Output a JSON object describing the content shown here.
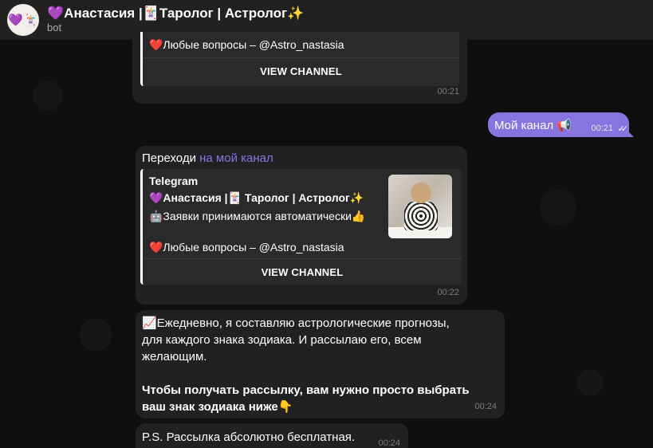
{
  "header": {
    "title": "💜Анастасия |🃏Таролог | Астролог✨",
    "subtitle": "bot",
    "avatar": "💜🃏"
  },
  "messages": {
    "top_partial": {
      "line": "❤️Любые вопросы – @Astro_nastasia",
      "button": "VIEW CHANNEL",
      "time": "00:21"
    },
    "outgoing": {
      "text": "Мой канал 📢",
      "time": "00:21",
      "ticks": "✓✓"
    },
    "channel_msg": {
      "text_prefix": "Переходи ",
      "link_text": "на мой канал",
      "preview_site": "Telegram",
      "preview_title": "💜Анастасия |🃏 Таролог | Астролог✨",
      "preview_line1": "🤖Заявки принимаются автоматически👍",
      "preview_line2": "❤️Любые вопросы – @Astro_nastasia",
      "button": "VIEW CHANNEL",
      "time": "00:22"
    },
    "horoscope_msg": {
      "line1": "📈Ежедневно, я составляю астрологические прогнозы,",
      "line2": "для каждого знака зодиака. И рассылаю его, всем",
      "line3": "желающим.",
      "line4": "Чтобы получать рассылку, вам нужно просто выбрать",
      "line5": "ваш знак зодиака ниже👇",
      "time": "00:24"
    },
    "ps_msg": {
      "text": "P.S. Рассылка абсолютно бесплатная.",
      "time": "00:24"
    }
  }
}
